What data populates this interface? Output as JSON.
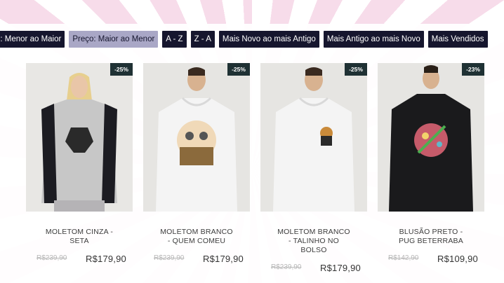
{
  "sort_options": [
    {
      "label": "o: Menor ao Maior",
      "active": false
    },
    {
      "label": "Preço: Maior ao Menor",
      "active": true
    },
    {
      "label": "A - Z",
      "active": false
    },
    {
      "label": "Z - A",
      "active": false
    },
    {
      "label": "Mais Novo ao mais Antigo",
      "active": false
    },
    {
      "label": "Mais Antigo ao mais Novo",
      "active": false
    },
    {
      "label": "Mais Vendidos",
      "active": false
    }
  ],
  "products": [
    {
      "badge": "-25%",
      "name_lines": [
        "MOLETOM CINZA -",
        "SETA"
      ],
      "old_price": "R$239,90",
      "price": "R$179,90"
    },
    {
      "badge": "-25%",
      "name_lines": [
        "MOLETOM BRANCO",
        "- QUEM COMEU"
      ],
      "old_price": "R$239,90",
      "price": "R$179,90"
    },
    {
      "badge": "-25%",
      "name_lines": [
        "MOLETOM BRANCO",
        "- TALINHO NO",
        "BOLSO"
      ],
      "old_price": "R$239,90",
      "price": "R$179,90"
    },
    {
      "badge": "-23%",
      "name_lines": [
        "BLUSÃO PRETO -",
        "PUG BETERRABA"
      ],
      "old_price": "R$142,90",
      "price": "R$109,90"
    }
  ],
  "colors": {
    "sort_bg": "#16162e",
    "sort_active_bg": "#a9a7c6",
    "badge_bg": "#1f3134",
    "background_ray": "#f7dcea"
  }
}
